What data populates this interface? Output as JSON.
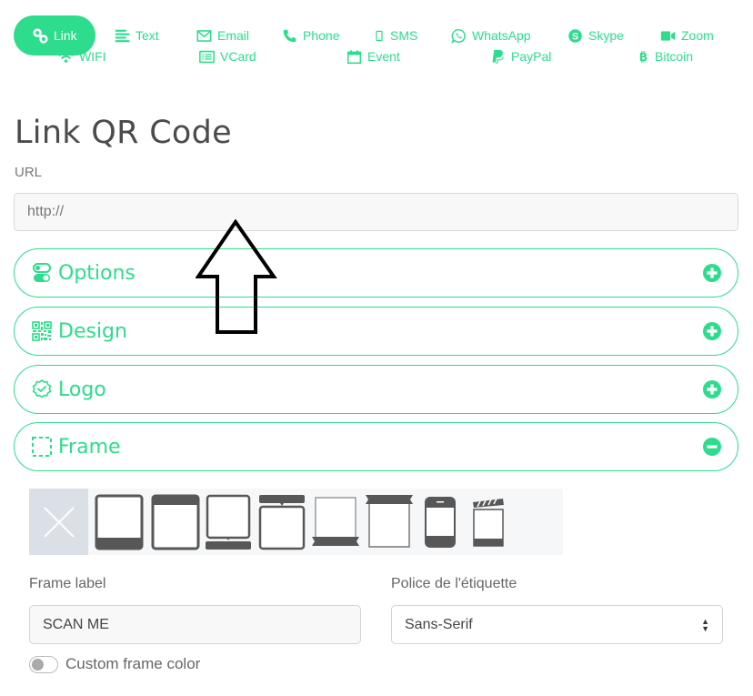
{
  "tabs_row1": [
    {
      "label": "Link",
      "icon": "link-icon",
      "active": true
    },
    {
      "label": "Text",
      "icon": "text-lines-icon",
      "active": false
    },
    {
      "label": "Email",
      "icon": "envelope-icon",
      "active": false
    },
    {
      "label": "Phone",
      "icon": "phone-icon",
      "active": false
    },
    {
      "label": "SMS",
      "icon": "mobile-icon",
      "active": false
    },
    {
      "label": "WhatsApp",
      "icon": "whatsapp-icon",
      "active": false
    },
    {
      "label": "Skype",
      "icon": "skype-icon",
      "active": false
    },
    {
      "label": "Zoom",
      "icon": "video-camera-icon",
      "active": false
    }
  ],
  "tabs_row2": [
    {
      "label": "WIFI",
      "icon": "wifi-icon"
    },
    {
      "label": "VCard",
      "icon": "vcard-icon"
    },
    {
      "label": "Event",
      "icon": "calendar-icon"
    },
    {
      "label": "PayPal",
      "icon": "paypal-icon"
    },
    {
      "label": "Bitcoin",
      "icon": "bitcoin-icon"
    }
  ],
  "page_title": "Link QR Code",
  "url": {
    "label": "URL",
    "placeholder": "http://",
    "value": ""
  },
  "accordions": [
    {
      "label": "Options",
      "icon": "toggles-icon",
      "state": "collapsed",
      "toggle_icon": "plus-circle-icon"
    },
    {
      "label": "Design",
      "icon": "qr-code-icon",
      "state": "collapsed",
      "toggle_icon": "plus-circle-icon"
    },
    {
      "label": "Logo",
      "icon": "badge-check-icon",
      "state": "collapsed",
      "toggle_icon": "plus-circle-icon"
    },
    {
      "label": "Frame",
      "icon": "dashed-frame-icon",
      "state": "expanded",
      "toggle_icon": "minus-circle-icon"
    }
  ],
  "frame_options": [
    {
      "name": "none",
      "selected": true
    },
    {
      "name": "bottom-bar"
    },
    {
      "name": "top-bar"
    },
    {
      "name": "bottom-tab"
    },
    {
      "name": "top-tab"
    },
    {
      "name": "bottom-ribbon"
    },
    {
      "name": "top-ribbon"
    },
    {
      "name": "phone"
    },
    {
      "name": "clapperboard"
    }
  ],
  "frame_label": {
    "label": "Frame label",
    "value": "SCAN ME"
  },
  "label_font": {
    "label": "Police de l'étiquette",
    "selected": "Sans-Serif"
  },
  "custom_frame_color": {
    "label": "Custom frame color",
    "enabled": false
  },
  "colors": {
    "accent": "#2ddc8c",
    "selected_frame_bg": "#dae0e6",
    "frame_icon": "#575757"
  }
}
